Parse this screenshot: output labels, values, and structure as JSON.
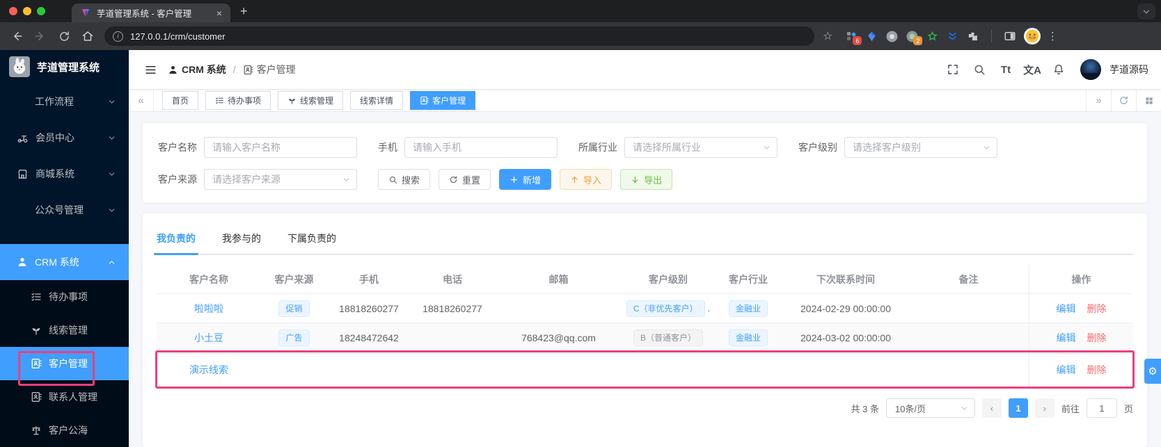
{
  "colors": {
    "accent": "#409eff",
    "danger": "#f56c6c",
    "warning": "#e6a23c",
    "success": "#67c23a",
    "annotation_pink": "#ed3f7c",
    "sidebar_bg": "#001529"
  },
  "browser": {
    "tab_title": "芋道管理系统 - 客户管理",
    "url": "127.0.0.1/crm/customer",
    "ext_badge_1": "6",
    "ext_badge_2": "2"
  },
  "glyphs": {
    "close": "×",
    "new_tab": "+",
    "chev_down": "⌄",
    "star": "☆",
    "kebab": "⋮",
    "info_i": "i",
    "dbl_left": "«",
    "dbl_right": "»",
    "chev_left": "‹",
    "chev_right": "›",
    "gear": "⚙",
    "emoji_face": "😄"
  },
  "sidebar": {
    "app_title": "芋道管理系统",
    "items": [
      {
        "label": "工作流程"
      },
      {
        "label": "会员中心"
      },
      {
        "label": "商城系统"
      },
      {
        "label": "公众号管理"
      },
      {
        "label": "CRM 系统"
      }
    ],
    "submenu": [
      {
        "label": "待办事项"
      },
      {
        "label": "线索管理"
      },
      {
        "label": "客户管理"
      },
      {
        "label": "联系人管理"
      },
      {
        "label": "客户公海"
      }
    ]
  },
  "header": {
    "breadcrumb_root": "CRM 系统",
    "breadcrumb_sep": "/",
    "breadcrumb_current": "客户管理",
    "font_size_icon_label": "Tt",
    "lang_icon_label": "文A",
    "username": "芋道源码"
  },
  "tabbar": {
    "tabs": [
      {
        "label": "首页"
      },
      {
        "label": "待办事项"
      },
      {
        "label": "线索管理"
      },
      {
        "label": "线索详情"
      },
      {
        "label": "客户管理"
      }
    ]
  },
  "filters": {
    "name_label": "客户名称",
    "name_placeholder": "请输入客户名称",
    "mobile_label": "手机",
    "mobile_placeholder": "请输入手机",
    "industry_label": "所属行业",
    "industry_placeholder": "请选择所属行业",
    "level_label": "客户级别",
    "level_placeholder": "请选择客户级别",
    "source_label": "客户来源",
    "source_placeholder": "请选择客户来源",
    "search_label": "搜索",
    "reset_label": "重置",
    "add_label": "新增",
    "import_label": "导入",
    "export_label": "导出"
  },
  "panel": {
    "tabs": [
      {
        "label": "我负责的"
      },
      {
        "label": "我参与的"
      },
      {
        "label": "下属负责的"
      }
    ],
    "columns": [
      "客户名称",
      "客户来源",
      "手机",
      "电话",
      "邮箱",
      "客户级别",
      "客户行业",
      "下次联系时间",
      "备注",
      "操作"
    ],
    "rows": [
      {
        "name": "啦啦啦",
        "source_tag": "促销",
        "mobile": "18818260277",
        "phone": "18818260277",
        "email": "",
        "level_tag": "C（非优先客户）",
        "level_suffix": ".",
        "industry_tag": "金融业",
        "next_time": "2024-02-29 00:00:00",
        "remark": "",
        "edit": "编辑",
        "delete": "删除"
      },
      {
        "name": "小土豆",
        "source_tag": "广告",
        "mobile": "18248472642",
        "phone": "",
        "email": "768423@qq.com",
        "level_tag": "B（普通客户）",
        "level_suffix": "",
        "industry_tag": "金融业",
        "next_time": "2024-03-02 00:00:00",
        "remark": "",
        "edit": "编辑",
        "delete": "删除"
      },
      {
        "name": "演示线索",
        "source_tag": "",
        "mobile": "",
        "phone": "",
        "email": "",
        "level_tag": "",
        "level_suffix": "",
        "industry_tag": "",
        "next_time": "",
        "remark": "",
        "edit": "编辑",
        "delete": "删除"
      }
    ],
    "pagination": {
      "total": "共 3 条",
      "page_size": "10条/页",
      "current_page": "1",
      "goto_label": "前往",
      "goto_value": "1",
      "page_unit": "页"
    }
  }
}
